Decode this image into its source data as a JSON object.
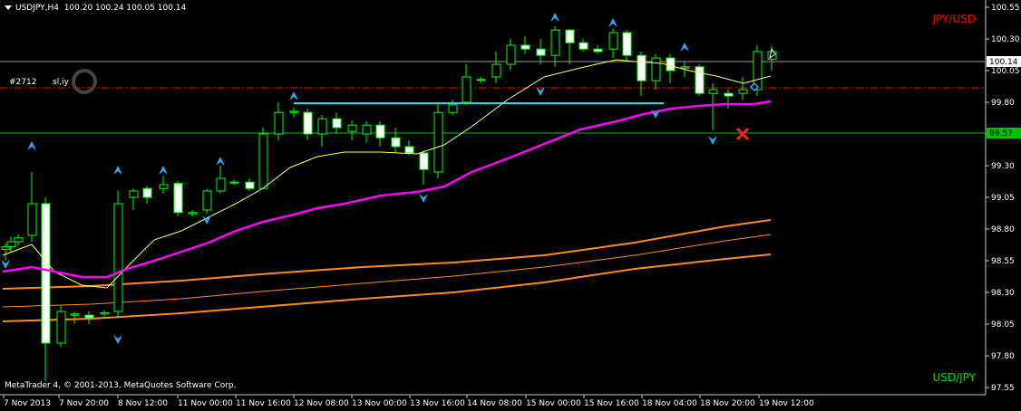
{
  "header": {
    "symbol_timeframe": "USDJPY,H4",
    "ohlc": "100.20 100.24 100.05 100.14"
  },
  "labels": {
    "pair_top": "JPY/USD",
    "pair_bottom": "USD/JPY",
    "copyright": "MetaTrader 4, © 2001-2013, MetaQuotes Software Corp.",
    "order_ticket": "#2712",
    "order_type": "sl,iy"
  },
  "price_axis": {
    "ticks": [
      "100.55",
      "100.30",
      "100.05",
      "99.80",
      "99.55",
      "99.30",
      "99.05",
      "98.80",
      "98.55",
      "98.30",
      "98.05",
      "97.80",
      "97.55"
    ],
    "current_price": "100.14",
    "line_price": "99.57"
  },
  "time_axis": {
    "ticks": [
      "7 Nov 2013",
      "7 Nov 20:00",
      "8 Nov 12:00",
      "11 Nov 00:00",
      "11 Nov 16:00",
      "12 Nov 08:00",
      "13 Nov 00:00",
      "13 Nov 16:00",
      "14 Nov 08:00",
      "15 Nov 00:00",
      "15 Nov 16:00",
      "18 Nov 04:00",
      "18 Nov 20:00",
      "19 Nov 12:00"
    ]
  },
  "colors": {
    "background": "#000000",
    "bull_candle": "#000000",
    "bear_candle": "#ffffff",
    "candle_outline": "#00ff00",
    "ma_fast": "#ffff66",
    "ma_slow": "#ff00ff",
    "envelope": "#ff8c1a",
    "hline": "#00e5ff",
    "bid_line": "#9a9a9a",
    "stop_line": "#ff0000",
    "price_line": "#00c000",
    "fractal": "#2aa8ff"
  }
}
